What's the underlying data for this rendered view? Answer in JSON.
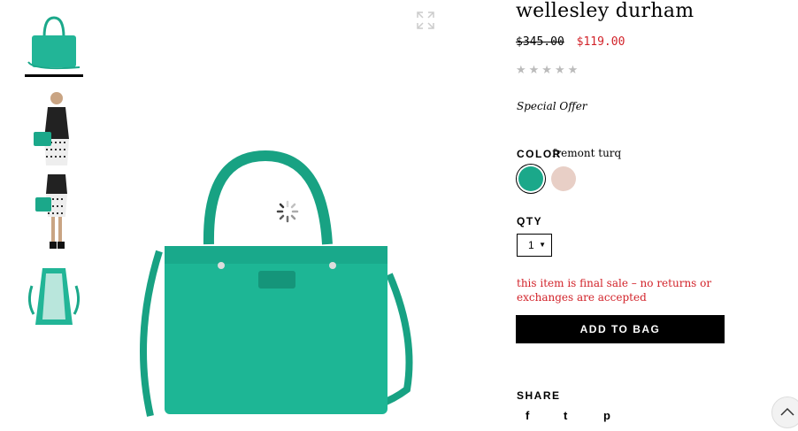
{
  "product": {
    "title": "wellesley durham",
    "old_price": "$345.00",
    "new_price": "$119.00",
    "stars": "★★★★★",
    "special_offer": "Special Offer",
    "color_label": "COLOR",
    "color_name": "fremont turq",
    "swatches": [
      "#1ba88a",
      "#e8cfc6"
    ],
    "qty_label": "QTY",
    "qty_value": "1",
    "final_sale": "this item is final sale – no returns or exchanges are accepted",
    "add_to_bag": "ADD TO BAG",
    "share_label": "SHARE",
    "social": [
      "f",
      "t",
      "p"
    ]
  },
  "colors": {
    "accent": "#d2232a",
    "bag": "#1ba88a"
  },
  "icons": [
    "expand-icon",
    "loading-spinner-icon",
    "facebook-icon",
    "twitter-icon",
    "pinterest-icon",
    "chevron-up-icon"
  ]
}
